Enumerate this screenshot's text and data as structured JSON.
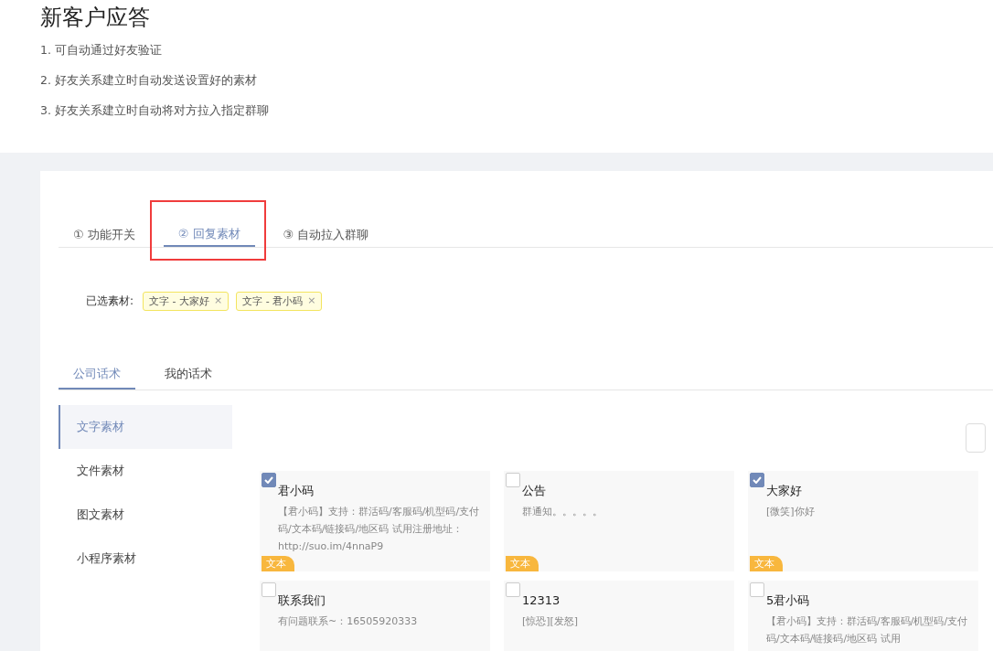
{
  "title": "新客户应答",
  "features": [
    "1. 可自动通过好友验证",
    "2. 好友关系建立时自动发送设置好的素材",
    "3. 好友关系建立时自动将对方拉入指定群聊"
  ],
  "steps": [
    {
      "mark": "①",
      "label": "功能开关",
      "selected": false,
      "highlighted": false
    },
    {
      "mark": "②",
      "label": "回复素材",
      "selected": true,
      "highlighted": true
    },
    {
      "mark": "③",
      "label": "自动拉入群聊",
      "selected": false,
      "highlighted": false
    }
  ],
  "selected_materials": {
    "label": "已选素材:",
    "tags": [
      {
        "text": "文字 - 大家好",
        "remove": "×"
      },
      {
        "text": "文字 - 君小码",
        "remove": "×"
      }
    ]
  },
  "script_tabs": [
    {
      "label": "公司话术",
      "selected": true
    },
    {
      "label": "我的话术",
      "selected": false
    }
  ],
  "categories": [
    {
      "label": "文字素材",
      "selected": true
    },
    {
      "label": "文件素材",
      "selected": false
    },
    {
      "label": "图文素材",
      "selected": false
    },
    {
      "label": "小程序素材",
      "selected": false
    }
  ],
  "cards": [
    {
      "checked": true,
      "title": "君小码",
      "body": "【君小码】支持：群活码/客服码/机型码/支付码/文本码/链接码/地区码 试用注册地址：http://suo.im/4nnaP9",
      "tag": "文本"
    },
    {
      "checked": false,
      "title": "公告",
      "body": "群通知。。。。。",
      "tag": "文本"
    },
    {
      "checked": true,
      "title": "大家好",
      "body": "[微笑]你好",
      "tag": "文本"
    },
    {
      "checked": false,
      "title": "联系我们",
      "body": "有问题联系~：16505920333"
    },
    {
      "checked": false,
      "title": "12313",
      "body": "[惊恐][发怒]"
    },
    {
      "checked": false,
      "title": "5君小码",
      "body": "【君小码】支持：群活码/客服码/机型码/支付码/文本码/链接码/地区码 试用"
    }
  ]
}
